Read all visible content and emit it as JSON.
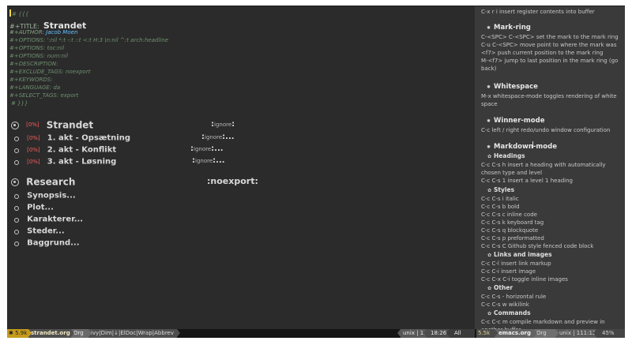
{
  "main": {
    "begin_marker": "# {{{",
    "title_key": "#+TITLE:",
    "title": "Strandet",
    "author_key": "#+AUTHOR:",
    "author": "Jacob Moen",
    "options": [
      "#+OPTIONS: ':nil *:t -:t ::t <:t H:3 \\n:nil ^:t arch:headline",
      "#+OPTIONS: toc:nil",
      "#+OPTIONS: num:nil",
      "#+DESCRIPTION:",
      "#+EXCLUDE_TAGS: noexport",
      "#+KEYWORDS:",
      "#+LANGUAGE: da",
      "#+SELECT_TAGS: export",
      "# }}}"
    ],
    "outline": {
      "strandet": {
        "percent": "[0%]",
        "label": "Strandet",
        "tag": "ignore"
      },
      "children": [
        {
          "percent": "[0%]",
          "label": "1. akt - Opsætning",
          "tag": "ignore"
        },
        {
          "percent": "[0%]",
          "label": "2. akt - Konflikt",
          "tag": "ignore"
        },
        {
          "percent": "[0%]",
          "label": "3. akt - Løsning",
          "tag": "ignore"
        }
      ],
      "research": {
        "label": "Research",
        "tag": ":noexport:"
      },
      "research_items": [
        "Synopsis...",
        "Plot...",
        "Karakterer...",
        "Steder...",
        "Baggrund..."
      ]
    }
  },
  "side": {
    "top_note": "C-x r i insert register contents into buffer",
    "mark_ring": {
      "title": "Mark-ring",
      "lines": [
        "C-<SPC> C-<SPC> set the mark to the mark ring",
        "C-u C-<SPC> move point to where the mark was",
        "<f7> push current position to the mark ring",
        "M-<f7> jump to last position in the mark ring (go back)"
      ]
    },
    "whitespace": {
      "title": "Whitespace",
      "text": "M-x whitespace-mode toggles rendering of white space"
    },
    "winner_mode": {
      "title": "Winner-mode",
      "text": "C-c  left / right redo/undo window configuration"
    },
    "markdown_mode": {
      "title": "Markdown-mode",
      "headings_title": "Headings",
      "headings": [
        "C-c C-s h insert a heading with automatically chosen type and level",
        "C-c C-s 1 insert a level 1 heading"
      ],
      "styles_title": "Styles",
      "styles": [
        "C-c C-s i italic",
        "C-c C-s b bold",
        "C-c C-s c inline code",
        "C-c C-s k keyboard tag",
        "C-c C-s q blockquote",
        "C-c C-s p preformatted",
        "C-c C-s C Github style fenced code block"
      ],
      "links_title": "Links and images",
      "links": [
        "C-c C-l insert link markup",
        "C-c C-i insert image",
        "C-c C-x C-i toggle inline images"
      ],
      "other_title": "Other",
      "other": [
        "C-c C-s - horizontal rule",
        "C-c C-s w wikilink"
      ],
      "commands_title": "Commands",
      "commands": [
        "C-c C-c m compile markdown and preview in another buffer"
      ]
    }
  },
  "modeline": {
    "left_size": "5.9k",
    "left_file": "strandet.org",
    "left_mode": "Org",
    "left_minor": "ivy|Dim|↓|ElDoc|Wrap|Abbrev",
    "format": "unix | 1:0",
    "time": "18:26",
    "position": "All",
    "right_size": "5.5k",
    "right_file": "emacs.org",
    "right_mode": "Org",
    "right_pos": "unix | 111:12",
    "right_pct": "45%"
  },
  "colors": {
    "background": "#2b2b2b",
    "side_background": "#3a3a3a",
    "accent_red": "#ff5b5b",
    "accent_blue": "#61c0ff",
    "modeline_yellow": "#c59b1c"
  },
  "icons": {
    "main_bullet": "circle-bullet-icon",
    "sub_bullet": "small-circle-bullet-icon",
    "section_star": "star-icon",
    "subsection_flower": "flower-icon"
  }
}
